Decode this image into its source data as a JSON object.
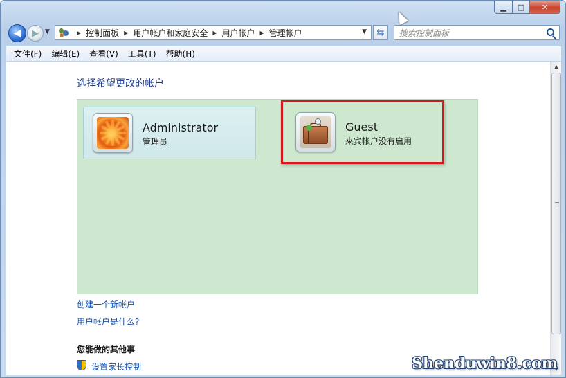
{
  "window": {
    "minimize_glyph": "▁",
    "maximize_glyph": "□",
    "close_glyph": "✕"
  },
  "nav": {
    "back_glyph": "◀",
    "forward_glyph": "▶",
    "recent_glyph": "▼",
    "refresh_glyph": "⇆"
  },
  "address": {
    "crumbs": [
      "控制面板",
      "用户帐户和家庭安全",
      "用户帐户",
      "管理帐户"
    ],
    "separator": "▶",
    "dropdown_glyph": "▼"
  },
  "search": {
    "placeholder": "搜索控制面板"
  },
  "menu": {
    "items": [
      "文件(F)",
      "编辑(E)",
      "查看(V)",
      "工具(T)",
      "帮助(H)"
    ]
  },
  "scrollbar": {
    "up_glyph": "▲",
    "down_glyph": "▼"
  },
  "content": {
    "title": "选择希望更改的帐户",
    "accounts": [
      {
        "name": "Administrator",
        "type": "管理员"
      },
      {
        "name": "Guest",
        "type": "来宾帐户没有启用"
      }
    ],
    "links": {
      "create": "创建一个新帐户",
      "what": "用户帐户是什么?"
    },
    "section_heading": "您能做的其他事",
    "parental_control": "设置家长控制"
  },
  "watermark": "Shenduwin8.com",
  "colors": {
    "panel_bg": "#cde8cf",
    "highlight": "#d8141c",
    "link": "#1553b4"
  }
}
